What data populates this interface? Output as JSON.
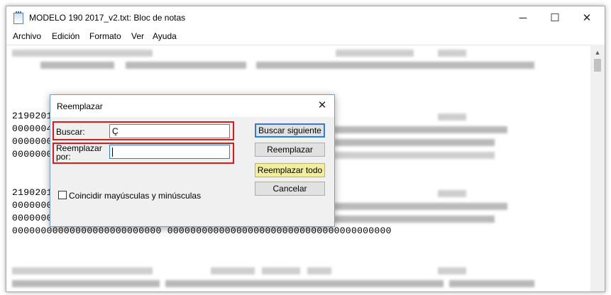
{
  "window": {
    "title": "MODELO 190 2017_v2.txt: Bloc de notas",
    "minimize": "─",
    "maximize": "☐",
    "close": "✕"
  },
  "menu": [
    "Archivo",
    "Edición",
    "Formato",
    "Ver",
    "Ayuda"
  ],
  "editor": {
    "lines": [
      {
        "text": "2190201"
      },
      {
        "text": "0000004"
      },
      {
        "text": "0000000"
      },
      {
        "text": "0000000"
      },
      {
        "text": "2190201"
      },
      {
        "text": "0000000"
      },
      {
        "text": "0000000"
      },
      {
        "text": "00000000000000000000000000 000000000000000000000000000000000000000"
      }
    ]
  },
  "dialog": {
    "title": "Reemplazar",
    "close": "✕",
    "find_label": "Buscar:",
    "find_value": "Ç",
    "replace_label_1": "Reemplazar",
    "replace_label_2": "por:",
    "replace_value": "",
    "find_next_button": "Buscar siguiente",
    "replace_button": "Reemplazar",
    "replace_all_button": "Reemplazar todo",
    "cancel_button": "Cancelar",
    "match_case_label": "Coincidir mayúsculas y minúsculas",
    "match_case_checked": false
  },
  "colors": {
    "highlight_border": "#e01818",
    "default_button_border": "#2f7fd0",
    "replace_all_bg": "#f1ee9e"
  }
}
